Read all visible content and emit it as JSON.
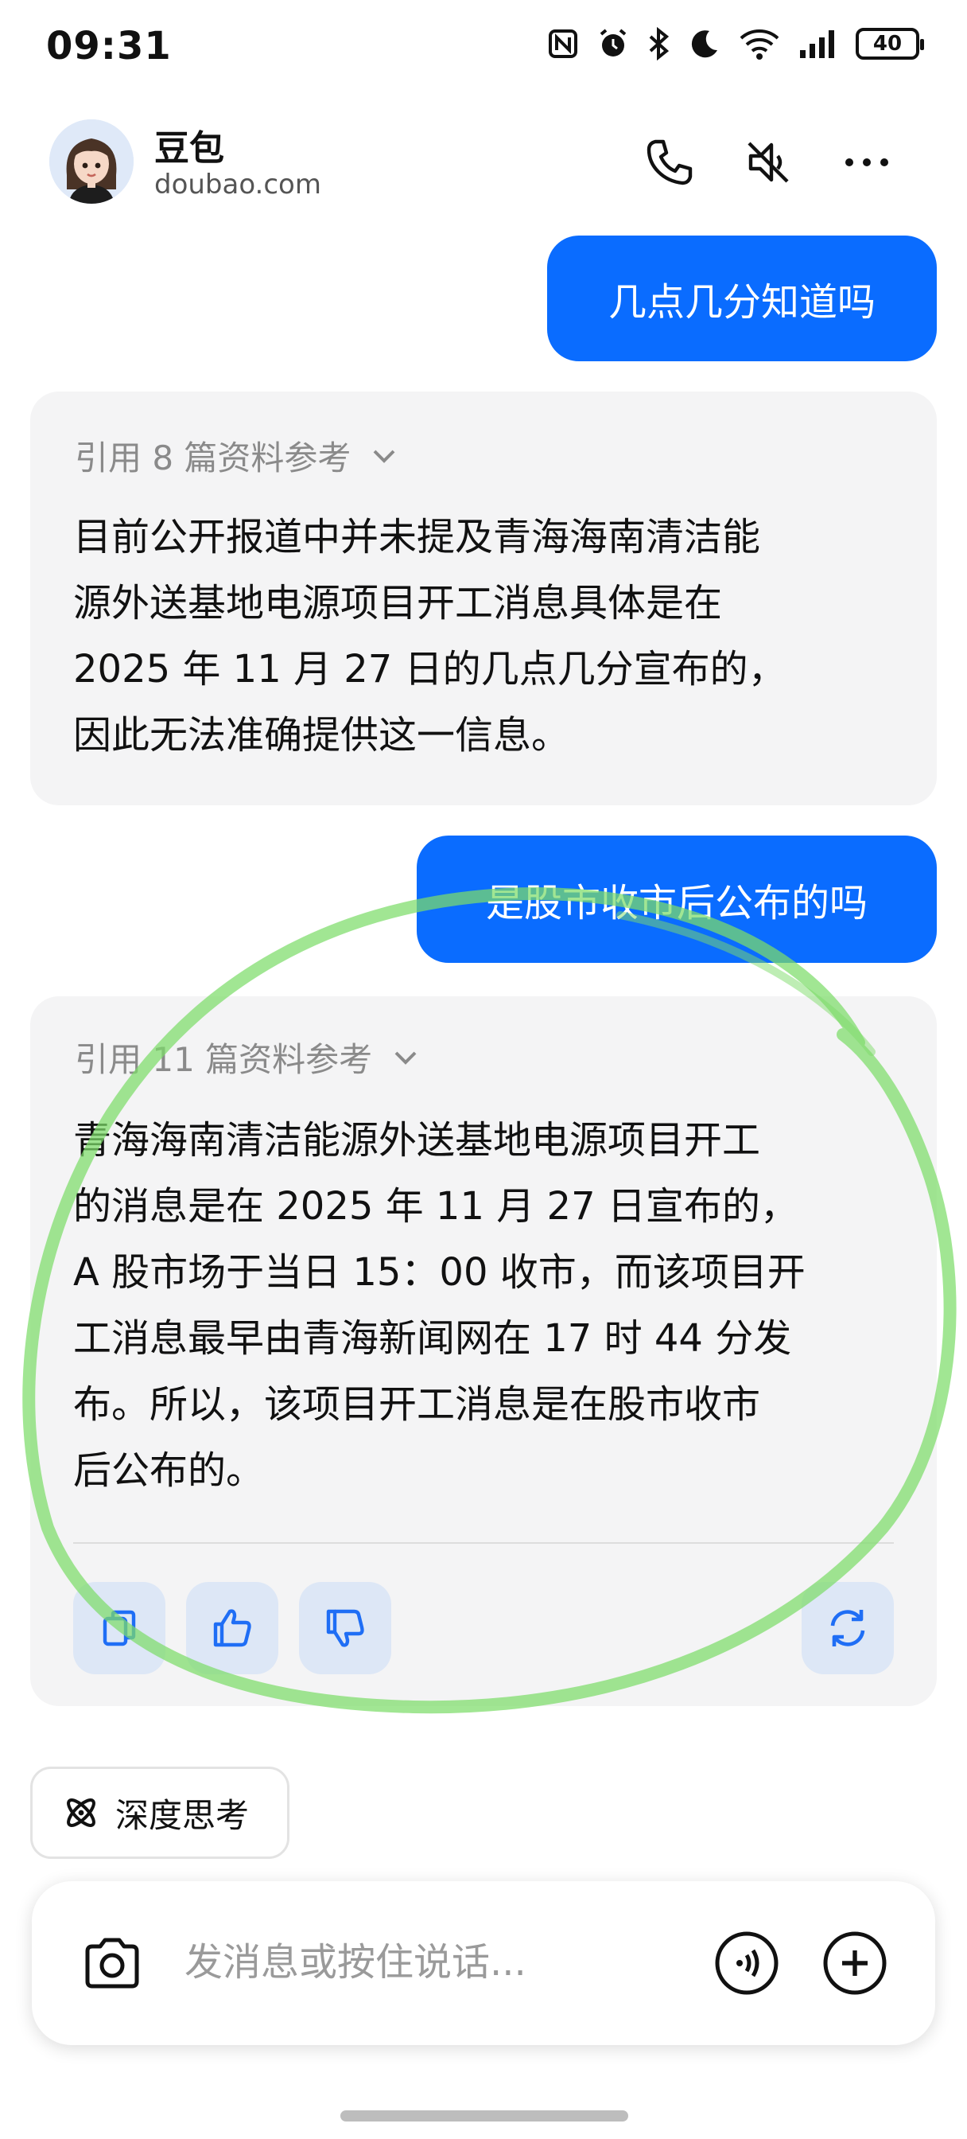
{
  "status_bar": {
    "time": "09:31",
    "battery": "40",
    "icons": [
      "nfc-icon",
      "alarm-icon",
      "bluetooth-icon",
      "moon-icon",
      "wifi-icon",
      "signal-icon",
      "battery-icon"
    ]
  },
  "header": {
    "name": "豆包",
    "domain": "doubao.com",
    "buttons": [
      "phone-icon",
      "speaker-mute-icon",
      "more-icon"
    ]
  },
  "chat": {
    "messages": [
      {
        "role": "user",
        "text": "几点几分知道吗"
      },
      {
        "role": "bot",
        "citation": "引用 8 篇资料参考",
        "lines": [
          "目前公开报道中并未提及青海海南清洁能",
          "源外送基地电源项目开工消息具体是在",
          "2025 年 11 月 27 日的几点几分宣布的，",
          "因此无法准确提供这一信息。"
        ]
      },
      {
        "role": "user",
        "text": "是股市收市后公布的吗"
      },
      {
        "role": "bot",
        "citation": "引用 11 篇资料参考",
        "lines": [
          "青海海南清洁能源外送基地电源项目开工",
          "的消息是在 2025 年 11 月 27 日宣布的，",
          "A 股市场于当日 15：00 收市，而该项目开",
          "工消息最早由青海新闻网在 17 时 44 分发",
          "布。所以，该项目开工消息是在股市收市",
          "后公布的。"
        ]
      }
    ],
    "actions": [
      "copy-icon",
      "thumbs-up-icon",
      "thumbs-down-icon",
      "regenerate-icon"
    ]
  },
  "deep_think": {
    "label": "深度思考"
  },
  "input": {
    "placeholder": "发消息或按住说话..."
  },
  "colors": {
    "accent": "#0a6cff",
    "bubble_bg": "#f4f4f5",
    "annotation": "#7ddc6a"
  }
}
